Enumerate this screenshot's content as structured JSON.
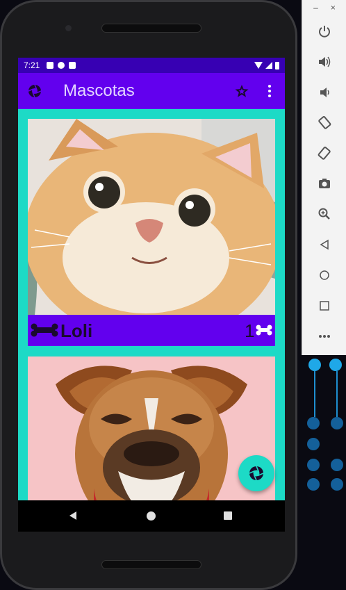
{
  "status_bar": {
    "time": "7:21"
  },
  "app_bar": {
    "title": "Mascotas"
  },
  "pets": [
    {
      "name": "Loli",
      "rating": "1"
    }
  ],
  "emulator_panel": {
    "minimize_label": "–",
    "close_label": "×",
    "controls": [
      "power-icon",
      "volume-up-icon",
      "volume-down-icon",
      "rotate-left-icon",
      "rotate-right-icon",
      "camera-icon",
      "zoom-icon",
      "back-icon",
      "home-icon",
      "overview-icon",
      "more-icon"
    ]
  },
  "colors": {
    "primary": "#6200ee",
    "primary_dark": "#3700b3",
    "accent": "#1ddac6"
  }
}
